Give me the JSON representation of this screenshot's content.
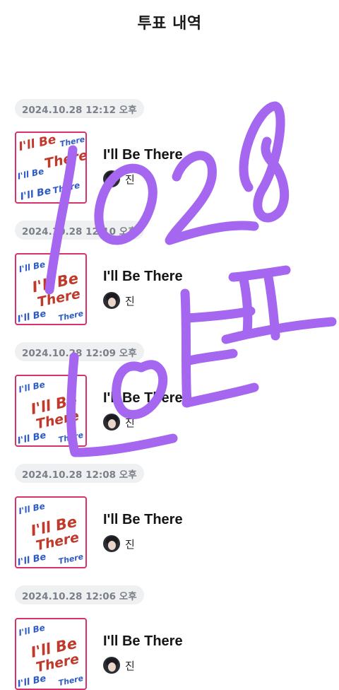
{
  "header": {
    "title": "투표 내역"
  },
  "votes": [
    {
      "date": "2024.10.28 12:12 오후",
      "song": "I'll Be There",
      "artist": "진"
    },
    {
      "date": "2024.10.28 12:10 오후",
      "song": "I'll Be There",
      "artist": "진"
    },
    {
      "date": "2024.10.28 12:09 오후",
      "song": "I'll Be There",
      "artist": "진"
    },
    {
      "date": "2024.10.28 12:08 오후",
      "song": "I'll Be There",
      "artist": "진"
    },
    {
      "date": "2024.10.28 12:06 오후",
      "song": "I'll Be There",
      "artist": "진"
    }
  ],
  "handwriting": {
    "text": "1028 LOEㅍ",
    "color": "#a566f0"
  },
  "colors": {
    "cover_border": "#d6336c",
    "pill_bg": "#eff0f2",
    "pill_text": "#7b8088"
  }
}
